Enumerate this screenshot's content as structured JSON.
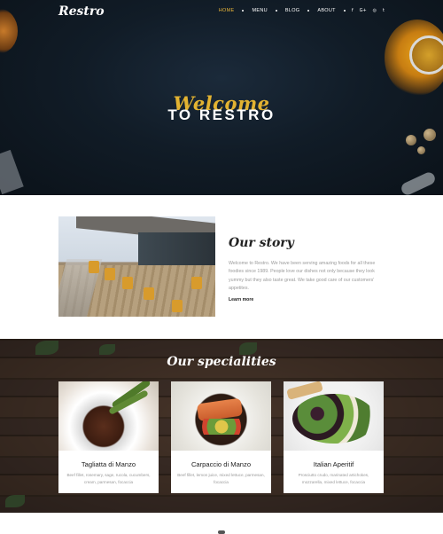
{
  "brand": {
    "logo": "Restro",
    "accent": "#e3b331"
  },
  "nav": {
    "items": [
      {
        "label": "HOME",
        "active": true
      },
      {
        "label": "MENU",
        "active": false
      },
      {
        "label": "BLOG",
        "active": false
      },
      {
        "label": "ABOUT",
        "active": false
      }
    ],
    "social": [
      {
        "icon": "facebook-icon",
        "glyph": "f"
      },
      {
        "icon": "google-plus-icon",
        "glyph": "G+"
      },
      {
        "icon": "instagram-icon",
        "glyph": "◎"
      },
      {
        "icon": "twitter-icon",
        "glyph": "t"
      }
    ]
  },
  "hero": {
    "welcome": "Welcome",
    "title": "TO RESTRO"
  },
  "story": {
    "title": "Our story",
    "text": "Welcome to Restro. We have been serving amazing foods for all these foodies since 1989. People love our dishes not only because they look yummy but they also taste great. We take good care of our customers' appetites.",
    "link": "Learn more"
  },
  "specialities": {
    "title": "Our specialities",
    "cards": [
      {
        "name": "Tagliatta di Manzo",
        "desc": "Beef fillet, rosemary, sage, rucola, cucumbers, cream, parmesan, focaccia"
      },
      {
        "name": "Carpaccio di Manzo",
        "desc": "Beef fillet, lemon juice, mixed lettuce, parmesan, focaccia"
      },
      {
        "name": "Italian Aperitif",
        "desc": "Prosciutto crudo, marinated artichokes, mozzarella, mixed lettuce, focaccia"
      }
    ]
  }
}
